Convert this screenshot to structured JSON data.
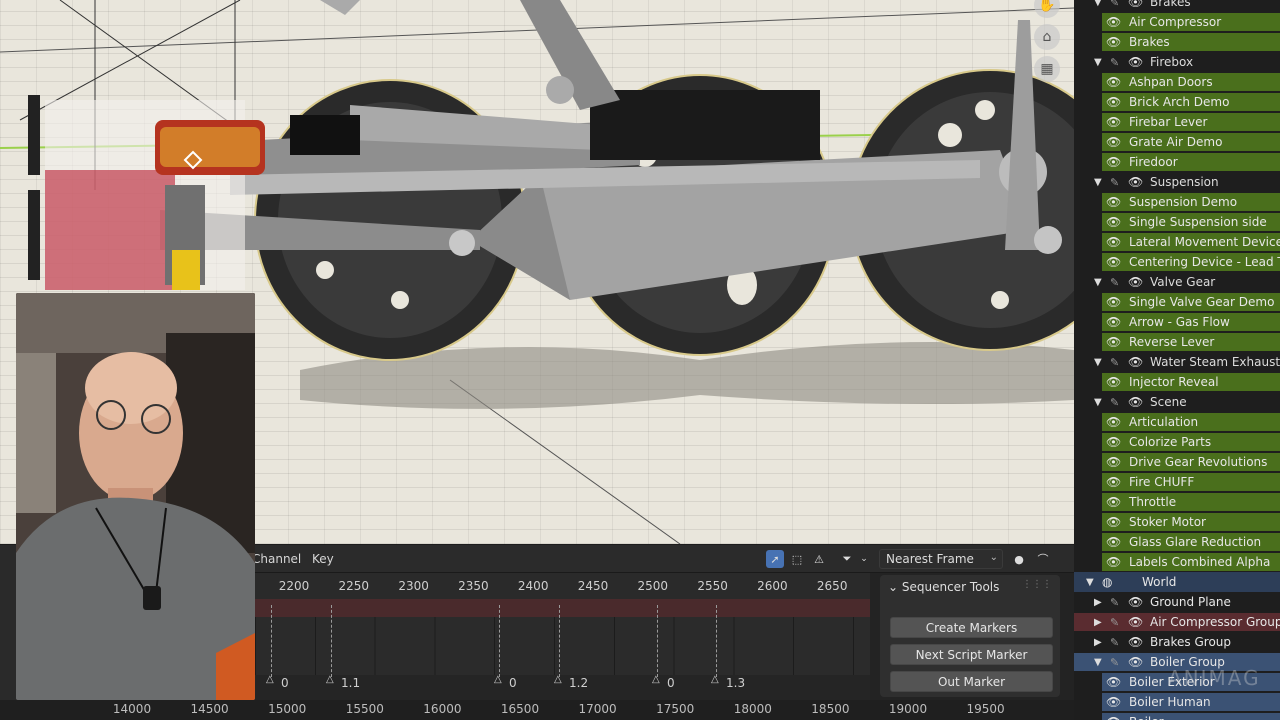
{
  "timeline": {
    "menu_channel": "Channel",
    "menu_key": "Key",
    "snap_mode": "Nearest Frame",
    "ruler_ticks": [
      "2200",
      "2250",
      "2300",
      "2350",
      "2400",
      "2450",
      "2500",
      "2550",
      "2600",
      "2650"
    ],
    "markers": [
      {
        "label": "0"
      },
      {
        "label": "1.1"
      },
      {
        "label": "0"
      },
      {
        "label": "1.2"
      },
      {
        "label": "0"
      },
      {
        "label": "1.3"
      }
    ],
    "bottom_ticks": [
      "14000",
      "14500",
      "15000",
      "15500",
      "16000",
      "16500",
      "17000",
      "17500",
      "18000",
      "18500",
      "19000",
      "19500"
    ]
  },
  "sequencer_tools": {
    "title": "Sequencer Tools",
    "create_markers": "Create Markers",
    "next_script_marker": "Next Script Marker",
    "out_marker": "Out Marker"
  },
  "outliner": {
    "items": [
      {
        "label": "Brakes",
        "type": "coll"
      },
      {
        "label": "Air Compressor",
        "type": "action"
      },
      {
        "label": "Brakes",
        "type": "action"
      },
      {
        "label": "Firebox",
        "type": "coll"
      },
      {
        "label": "Ashpan Doors",
        "type": "action"
      },
      {
        "label": "Brick Arch Demo",
        "type": "action"
      },
      {
        "label": "Firebar Lever",
        "type": "action"
      },
      {
        "label": "Grate Air Demo",
        "type": "action"
      },
      {
        "label": "Firedoor",
        "type": "action"
      },
      {
        "label": "Suspension",
        "type": "coll"
      },
      {
        "label": "Suspension Demo",
        "type": "action"
      },
      {
        "label": "Single Suspension side",
        "type": "action"
      },
      {
        "label": "Lateral Movement Device",
        "type": "action"
      },
      {
        "label": "Centering Device - Lead Tr",
        "type": "action"
      },
      {
        "label": "Valve Gear",
        "type": "coll"
      },
      {
        "label": "Single Valve Gear Demo",
        "type": "action"
      },
      {
        "label": "Arrow - Gas Flow",
        "type": "action"
      },
      {
        "label": "Reverse Lever",
        "type": "action"
      },
      {
        "label": "Water Steam Exhaust",
        "type": "coll"
      },
      {
        "label": "Injector Reveal",
        "type": "action"
      },
      {
        "label": "Scene",
        "type": "coll"
      },
      {
        "label": "Articulation",
        "type": "action"
      },
      {
        "label": "Colorize Parts",
        "type": "action"
      },
      {
        "label": "Drive Gear Revolutions",
        "type": "action"
      },
      {
        "label": "Fire CHUFF",
        "type": "action"
      },
      {
        "label": "Throttle",
        "type": "action"
      },
      {
        "label": "Stoker Motor",
        "type": "action"
      },
      {
        "label": "Glass Glare Reduction",
        "type": "action"
      },
      {
        "label": "Labels Combined Alpha",
        "type": "action"
      },
      {
        "label": "World",
        "type": "world"
      },
      {
        "label": "Ground Plane",
        "type": "group"
      },
      {
        "label": "Air Compressor Group",
        "type": "group-red"
      },
      {
        "label": "Brakes Group",
        "type": "group"
      },
      {
        "label": "Boiler Group",
        "type": "group-open"
      },
      {
        "label": "Boiler Exterior",
        "type": "child"
      },
      {
        "label": "Boiler Human",
        "type": "child"
      },
      {
        "label": "Boiler",
        "type": "child"
      }
    ],
    "watermark": "ANIMAG"
  },
  "colors": {
    "viewport_bg": "#e9e6dc",
    "outliner_green": "#4a6f1c",
    "outliner_blue": "#3b5274",
    "marker_strip": "#4a2a2c",
    "active_tool": "#4772b3"
  }
}
